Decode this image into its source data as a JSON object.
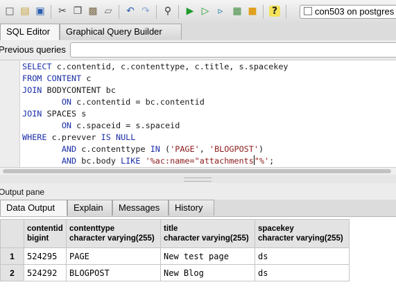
{
  "toolbar": {
    "icons": [
      "new-file-icon",
      "open-folder-icon",
      "save-icon",
      "cut-icon",
      "copy-icon",
      "paste-icon",
      "clear-icon",
      "undo-icon",
      "redo-icon",
      "find-icon",
      "execute-icon",
      "explain-icon",
      "execute-to-file-icon",
      "explain-analyze-icon",
      "stop-icon",
      "help-icon"
    ],
    "connection": "con503 on postgres"
  },
  "editor_tabs": [
    {
      "label": "SQL Editor",
      "active": true
    },
    {
      "label": "Graphical Query Builder",
      "active": false
    }
  ],
  "previous_queries": {
    "label": "Previous queries",
    "value": ""
  },
  "sql": {
    "lines": [
      [
        [
          "kw",
          "SELECT"
        ],
        [
          "t",
          " c.contentid, c.contenttype, c.title, s.spacekey"
        ]
      ],
      [
        [
          "kw",
          "FROM"
        ],
        [
          "t",
          " "
        ],
        [
          "kw",
          "CONTENT"
        ],
        [
          "t",
          " c"
        ]
      ],
      [
        [
          "kw",
          "JOIN"
        ],
        [
          "t",
          " BODYCONTENT bc"
        ]
      ],
      [
        [
          "t",
          "        "
        ],
        [
          "kw",
          "ON"
        ],
        [
          "t",
          " c.contentid = bc.contentid"
        ]
      ],
      [
        [
          "kw",
          "JOIN"
        ],
        [
          "t",
          " SPACES s"
        ]
      ],
      [
        [
          "t",
          "        "
        ],
        [
          "kw",
          "ON"
        ],
        [
          "t",
          " c.spaceid = s.spaceid"
        ]
      ],
      [
        [
          "kw",
          "WHERE"
        ],
        [
          "t",
          " c.prevver "
        ],
        [
          "kw",
          "IS NULL"
        ]
      ],
      [
        [
          "t",
          "        "
        ],
        [
          "kw",
          "AND"
        ],
        [
          "t",
          " c.contenttype "
        ],
        [
          "kw",
          "IN"
        ],
        [
          "t",
          " ("
        ],
        [
          "str",
          "'PAGE'"
        ],
        [
          "t",
          ", "
        ],
        [
          "str",
          "'BLOGPOST'"
        ],
        [
          "t",
          ")"
        ]
      ],
      [
        [
          "t",
          "        "
        ],
        [
          "kw",
          "AND"
        ],
        [
          "t",
          " bc.body "
        ],
        [
          "kw",
          "LIKE"
        ],
        [
          "t",
          " "
        ],
        [
          "str",
          "'%ac:name=\"attachments"
        ],
        [
          "caret",
          ""
        ],
        [
          "str",
          "\"%'"
        ],
        [
          "t",
          ";"
        ]
      ]
    ]
  },
  "output_pane": {
    "label": "Output pane",
    "tabs": [
      {
        "label": "Data Output",
        "active": true
      },
      {
        "label": "Explain",
        "active": false
      },
      {
        "label": "Messages",
        "active": false
      },
      {
        "label": "History",
        "active": false
      }
    ]
  },
  "result": {
    "columns": [
      {
        "name": "contentid",
        "type": "bigint"
      },
      {
        "name": "contenttype",
        "type": "character varying(255)"
      },
      {
        "name": "title",
        "type": "character varying(255)"
      },
      {
        "name": "spacekey",
        "type": "character varying(255)"
      }
    ],
    "rows": [
      {
        "num": "1",
        "cells": [
          "524295",
          "PAGE",
          "New test page",
          "ds"
        ]
      },
      {
        "num": "2",
        "cells": [
          "524292",
          "BLOGPOST",
          "New Blog",
          "ds"
        ]
      }
    ]
  }
}
